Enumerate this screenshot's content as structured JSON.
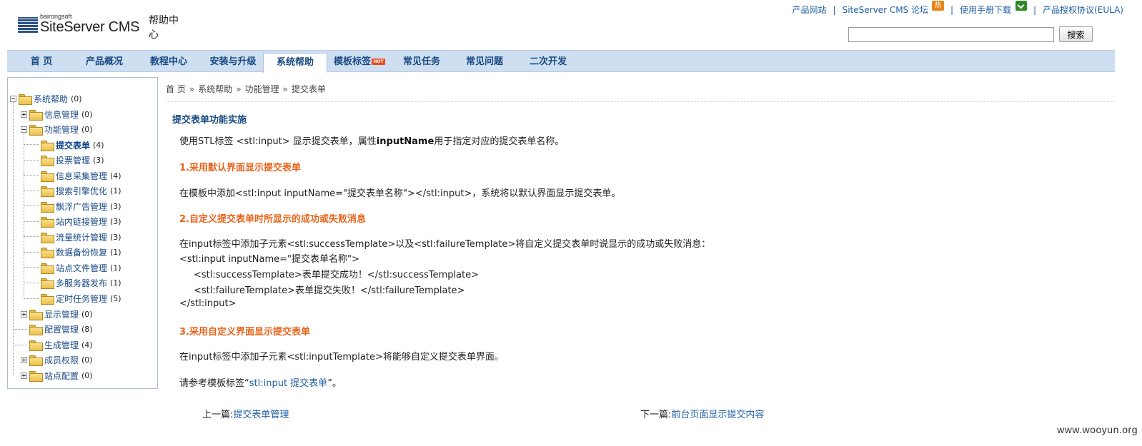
{
  "logo": {
    "small": "bairongsoft",
    "big": "SiteServer CMS",
    "cn": "帮助中心"
  },
  "toplinks": {
    "product_site": "产品网站",
    "forum": "SiteServer CMS 论坛",
    "forum_badge": "热",
    "manual": "使用手册下载",
    "eula": "产品授权协议(EULA)",
    "separator": "|"
  },
  "search": {
    "value": "",
    "button": "搜索"
  },
  "nav": {
    "items": [
      {
        "label": "首 页"
      },
      {
        "label": "产品概况"
      },
      {
        "label": "教程中心"
      },
      {
        "label": "安装与升级"
      },
      {
        "label": "系统帮助"
      },
      {
        "label": "模板标签",
        "badge": "HOT"
      },
      {
        "label": "常见任务"
      },
      {
        "label": "常见问题"
      },
      {
        "label": "二次开发"
      }
    ],
    "active_index": 4
  },
  "tree": {
    "root": {
      "label": "系统帮助",
      "count": "(0)"
    },
    "items": [
      {
        "label": "信息管理",
        "count": "(0)"
      },
      {
        "label": "功能管理",
        "count": "(0)"
      },
      {
        "label": "提交表单",
        "count": "(4)"
      },
      {
        "label": "投票管理",
        "count": "(3)"
      },
      {
        "label": "信息采集管理",
        "count": "(4)"
      },
      {
        "label": "搜索引擎优化",
        "count": "(1)"
      },
      {
        "label": "飘浮广告管理",
        "count": "(3)"
      },
      {
        "label": "站内链接管理",
        "count": "(3)"
      },
      {
        "label": "流量统计管理",
        "count": "(3)"
      },
      {
        "label": "数据备份恢复",
        "count": "(1)"
      },
      {
        "label": "站点文件管理",
        "count": "(1)"
      },
      {
        "label": "多服务器发布",
        "count": "(1)"
      },
      {
        "label": "定时任务管理",
        "count": "(5)"
      },
      {
        "label": "显示管理",
        "count": "(0)"
      },
      {
        "label": "配置管理",
        "count": "(8)"
      },
      {
        "label": "生成管理",
        "count": "(4)"
      },
      {
        "label": "成员权限",
        "count": "(0)"
      },
      {
        "label": "站点配置",
        "count": "(0)"
      }
    ]
  },
  "breadcrumb": {
    "items": [
      "首 页",
      "系统帮助",
      "功能管理",
      "提交表单"
    ],
    "separator": "»"
  },
  "article": {
    "title": "提交表单功能实施",
    "intro_pre": "使用STL标签 <stl:input> 显示提交表单，属性",
    "intro_bold": "inputName",
    "intro_post": "用于指定对应的提交表单名称。",
    "section1_title": "1.采用默认界面显示提交表单",
    "section1_text": "在模板中添加<stl:input inputName=\"提交表单名称\"></stl:input>，系统将以默认界面显示提交表单。",
    "section2_title": "2.自定义提交表单时所显示的成功或失败消息",
    "section2_text": "在input标签中添加子元素<stl:successTemplate>以及<stl:failureTemplate>将自定义提交表单时说显示的成功或失败消息：",
    "code": [
      "<stl:input inputName=\"提交表单名称\">",
      "<stl:successTemplate>表单提交成功！</stl:successTemplate>",
      "<stl:failureTemplate>表单提交失败！</stl:failureTemplate>",
      "</stl:input>"
    ],
    "section3_title": "3.采用自定义界面显示提交表单",
    "section3_text": "在input标签中添加子元素<stl:inputTemplate>将能够自定义提交表单界面。",
    "ref_pre": "请参考模板标签“",
    "ref_link": "stl:input 提交表单",
    "ref_post": "”。"
  },
  "pager": {
    "prev_label": "上一篇:",
    "prev_link": "提交表单管理",
    "next_label": "下一篇:",
    "next_link": "前台页面显示提交内容"
  },
  "watermark": "www.wooyun.org"
}
